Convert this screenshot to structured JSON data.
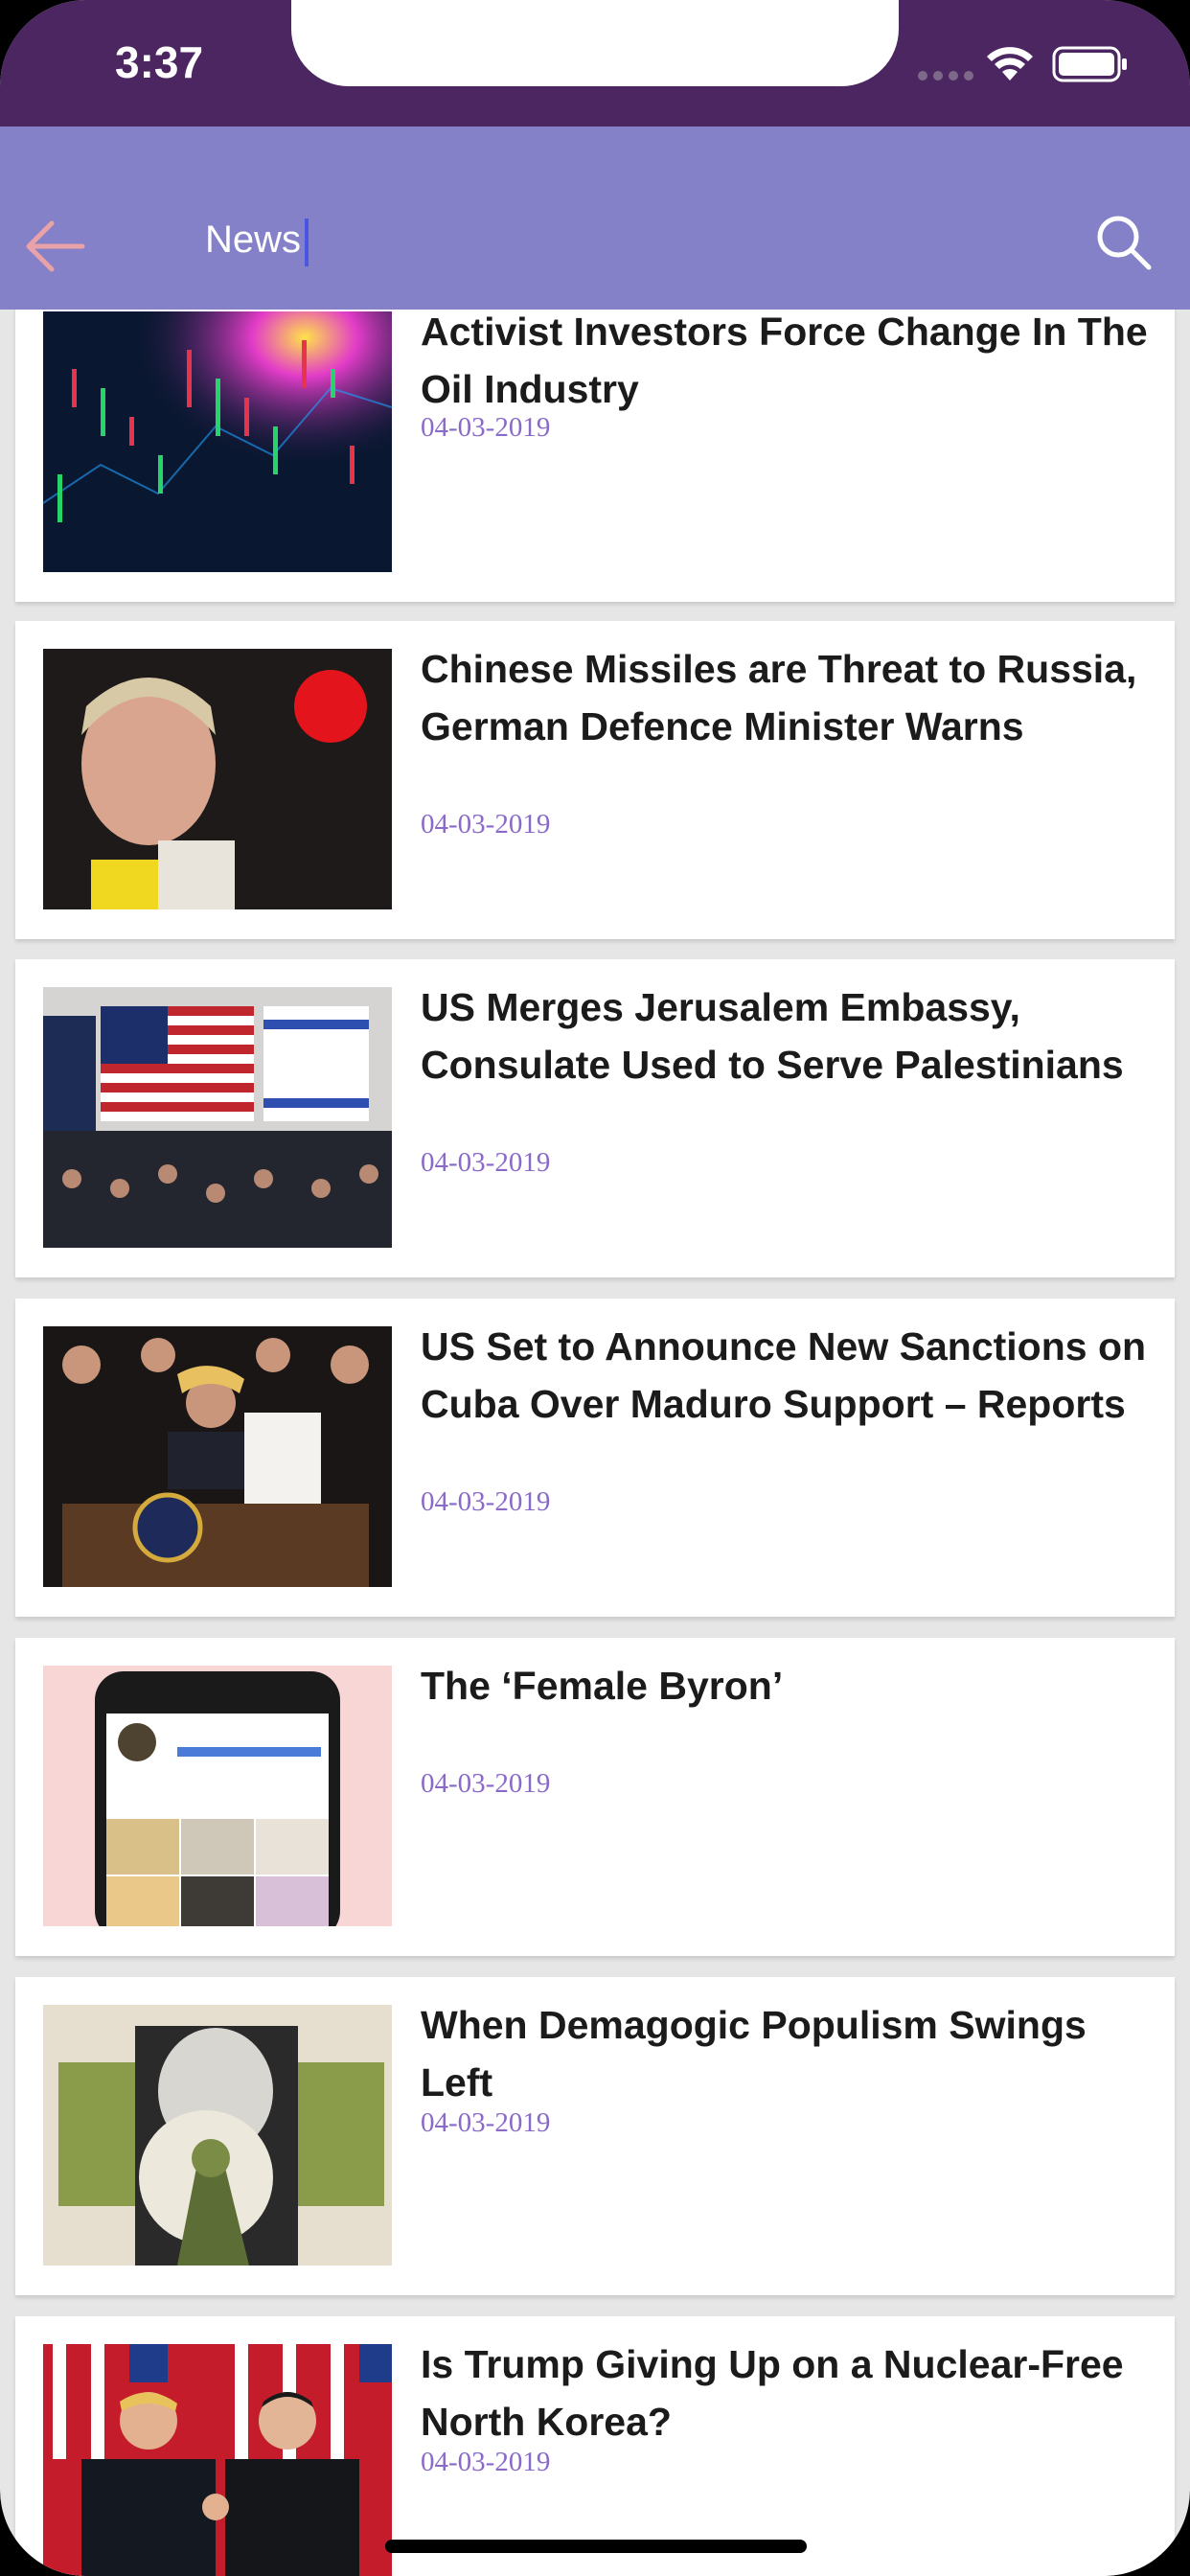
{
  "status_bar": {
    "time": "3:37"
  },
  "nav": {
    "title": "News",
    "back_icon": "arrow-left-icon",
    "search_icon": "search-icon"
  },
  "articles": [
    {
      "title": "Activist Investors Force Change In The Oil Industry",
      "date": "04-03-2019",
      "image": "stock-chart-image"
    },
    {
      "title": "Chinese Missiles are Threat to Russia, German Defence Minister Warns",
      "date": "04-03-2019",
      "image": "minister-portrait-image"
    },
    {
      "title": "US Merges Jerusalem Embassy, Consulate Used to Serve Palestinians",
      "date": "04-03-2019",
      "image": "embassy-ceremony-image"
    },
    {
      "title": "US Set to Announce New Sanctions on Cuba Over Maduro Support – Reports",
      "date": "04-03-2019",
      "image": "signing-ceremony-image"
    },
    {
      "title": "The ‘Female Byron’",
      "date": "04-03-2019",
      "image": "phone-instagram-image"
    },
    {
      "title": "When Demagogic Populism Swings Left",
      "date": "04-03-2019",
      "image": "collage-illustration-image"
    },
    {
      "title": "Is Trump Giving Up on a Nuclear-Free North Korea?",
      "date": "04-03-2019",
      "image": "handshake-image"
    }
  ],
  "colors": {
    "status_bar": "#4b2660",
    "nav_bar": "#8481c8",
    "date": "#8a6ac8",
    "back_arrow": "#e9a2a8"
  }
}
